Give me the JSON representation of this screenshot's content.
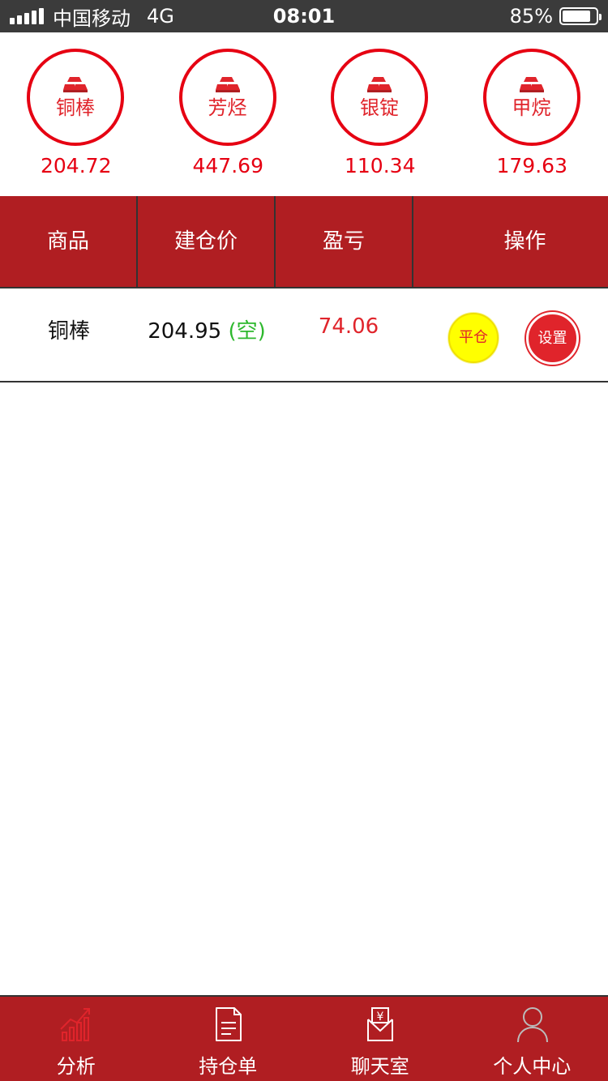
{
  "status_bar": {
    "carrier": "中国移动",
    "network": "4G",
    "time": "08:01",
    "battery": "85%",
    "battery_level": 0.85
  },
  "quotes": [
    {
      "name": "铜棒",
      "price": "204.72"
    },
    {
      "name": "芳烃",
      "price": "447.69"
    },
    {
      "name": "银锭",
      "price": "110.34"
    },
    {
      "name": "甲烷",
      "price": "179.63"
    }
  ],
  "table": {
    "headers": [
      "商品",
      "建仓价",
      "盈亏",
      "操作"
    ],
    "rows": [
      {
        "name": "铜棒",
        "price": "204.95",
        "direction": "(空)",
        "pl": "74.06",
        "close_label": "平仓",
        "settings_label": "设置"
      }
    ]
  },
  "tabs": [
    {
      "label": "分析",
      "icon": "chart-up-icon"
    },
    {
      "label": "持仓单",
      "icon": "document-icon"
    },
    {
      "label": "聊天室",
      "icon": "yen-envelope-icon"
    },
    {
      "label": "个人中心",
      "icon": "user-icon"
    }
  ],
  "colors": {
    "accent": "#b01e22",
    "price_red": "#e60012",
    "short_green": "#2db82d",
    "close_button": "#ffff00"
  }
}
